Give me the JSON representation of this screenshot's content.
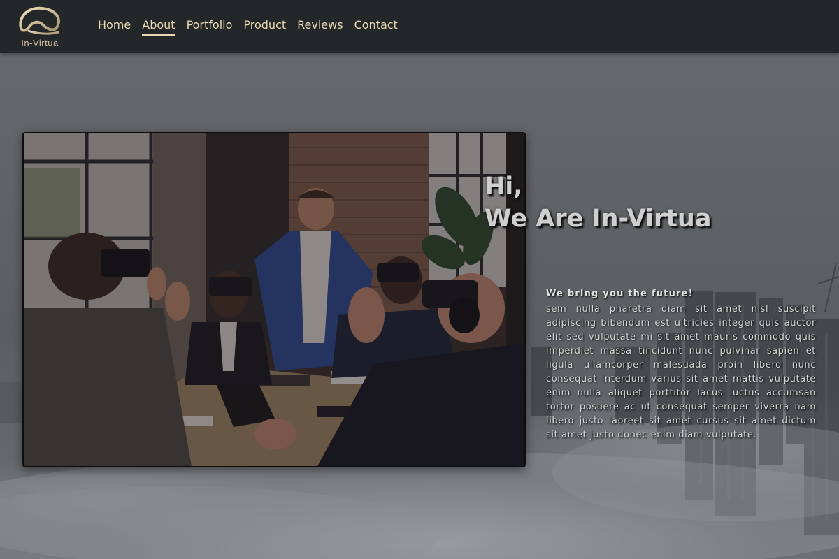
{
  "brand": {
    "name": "In-Virtua",
    "logo_icon": "vr-headset-swoosh-icon",
    "color": "#d3c3a3"
  },
  "nav": {
    "items": [
      {
        "label": "Home",
        "active": false
      },
      {
        "label": "About",
        "active": true
      },
      {
        "label": "Portfolio",
        "active": false
      },
      {
        "label": "Product",
        "active": false
      },
      {
        "label": "Reviews",
        "active": false
      },
      {
        "label": "Contact",
        "active": false
      }
    ],
    "color": "#e9d9b3",
    "background": "#23272a"
  },
  "hero": {
    "photo_alt": "people-using-vr-headsets-in-meeting-photo",
    "heading_line1": "Hi,",
    "heading_line2": "We Are In-Virtua",
    "tagline": "We bring you the future!",
    "body": "sem nulla pharetra diam sit amet nisl suscipit adipiscing bibendum est ultricies integer quis auctor elit sed vulputate mi sit amet mauris commodo quis imperdiet massa tincidunt nunc pulvinar sapien et ligula ullamcorper malesuada proin libero nunc consequat interdum varius sit amet mattis vulputate enim nulla aliquet porttitor lacus luctus accumsan tortor posuere ac ut consequat semper viverra nam libero justo laoreet sit amet cursus sit amet dictum sit amet justo donec enim diam vulputate."
  }
}
